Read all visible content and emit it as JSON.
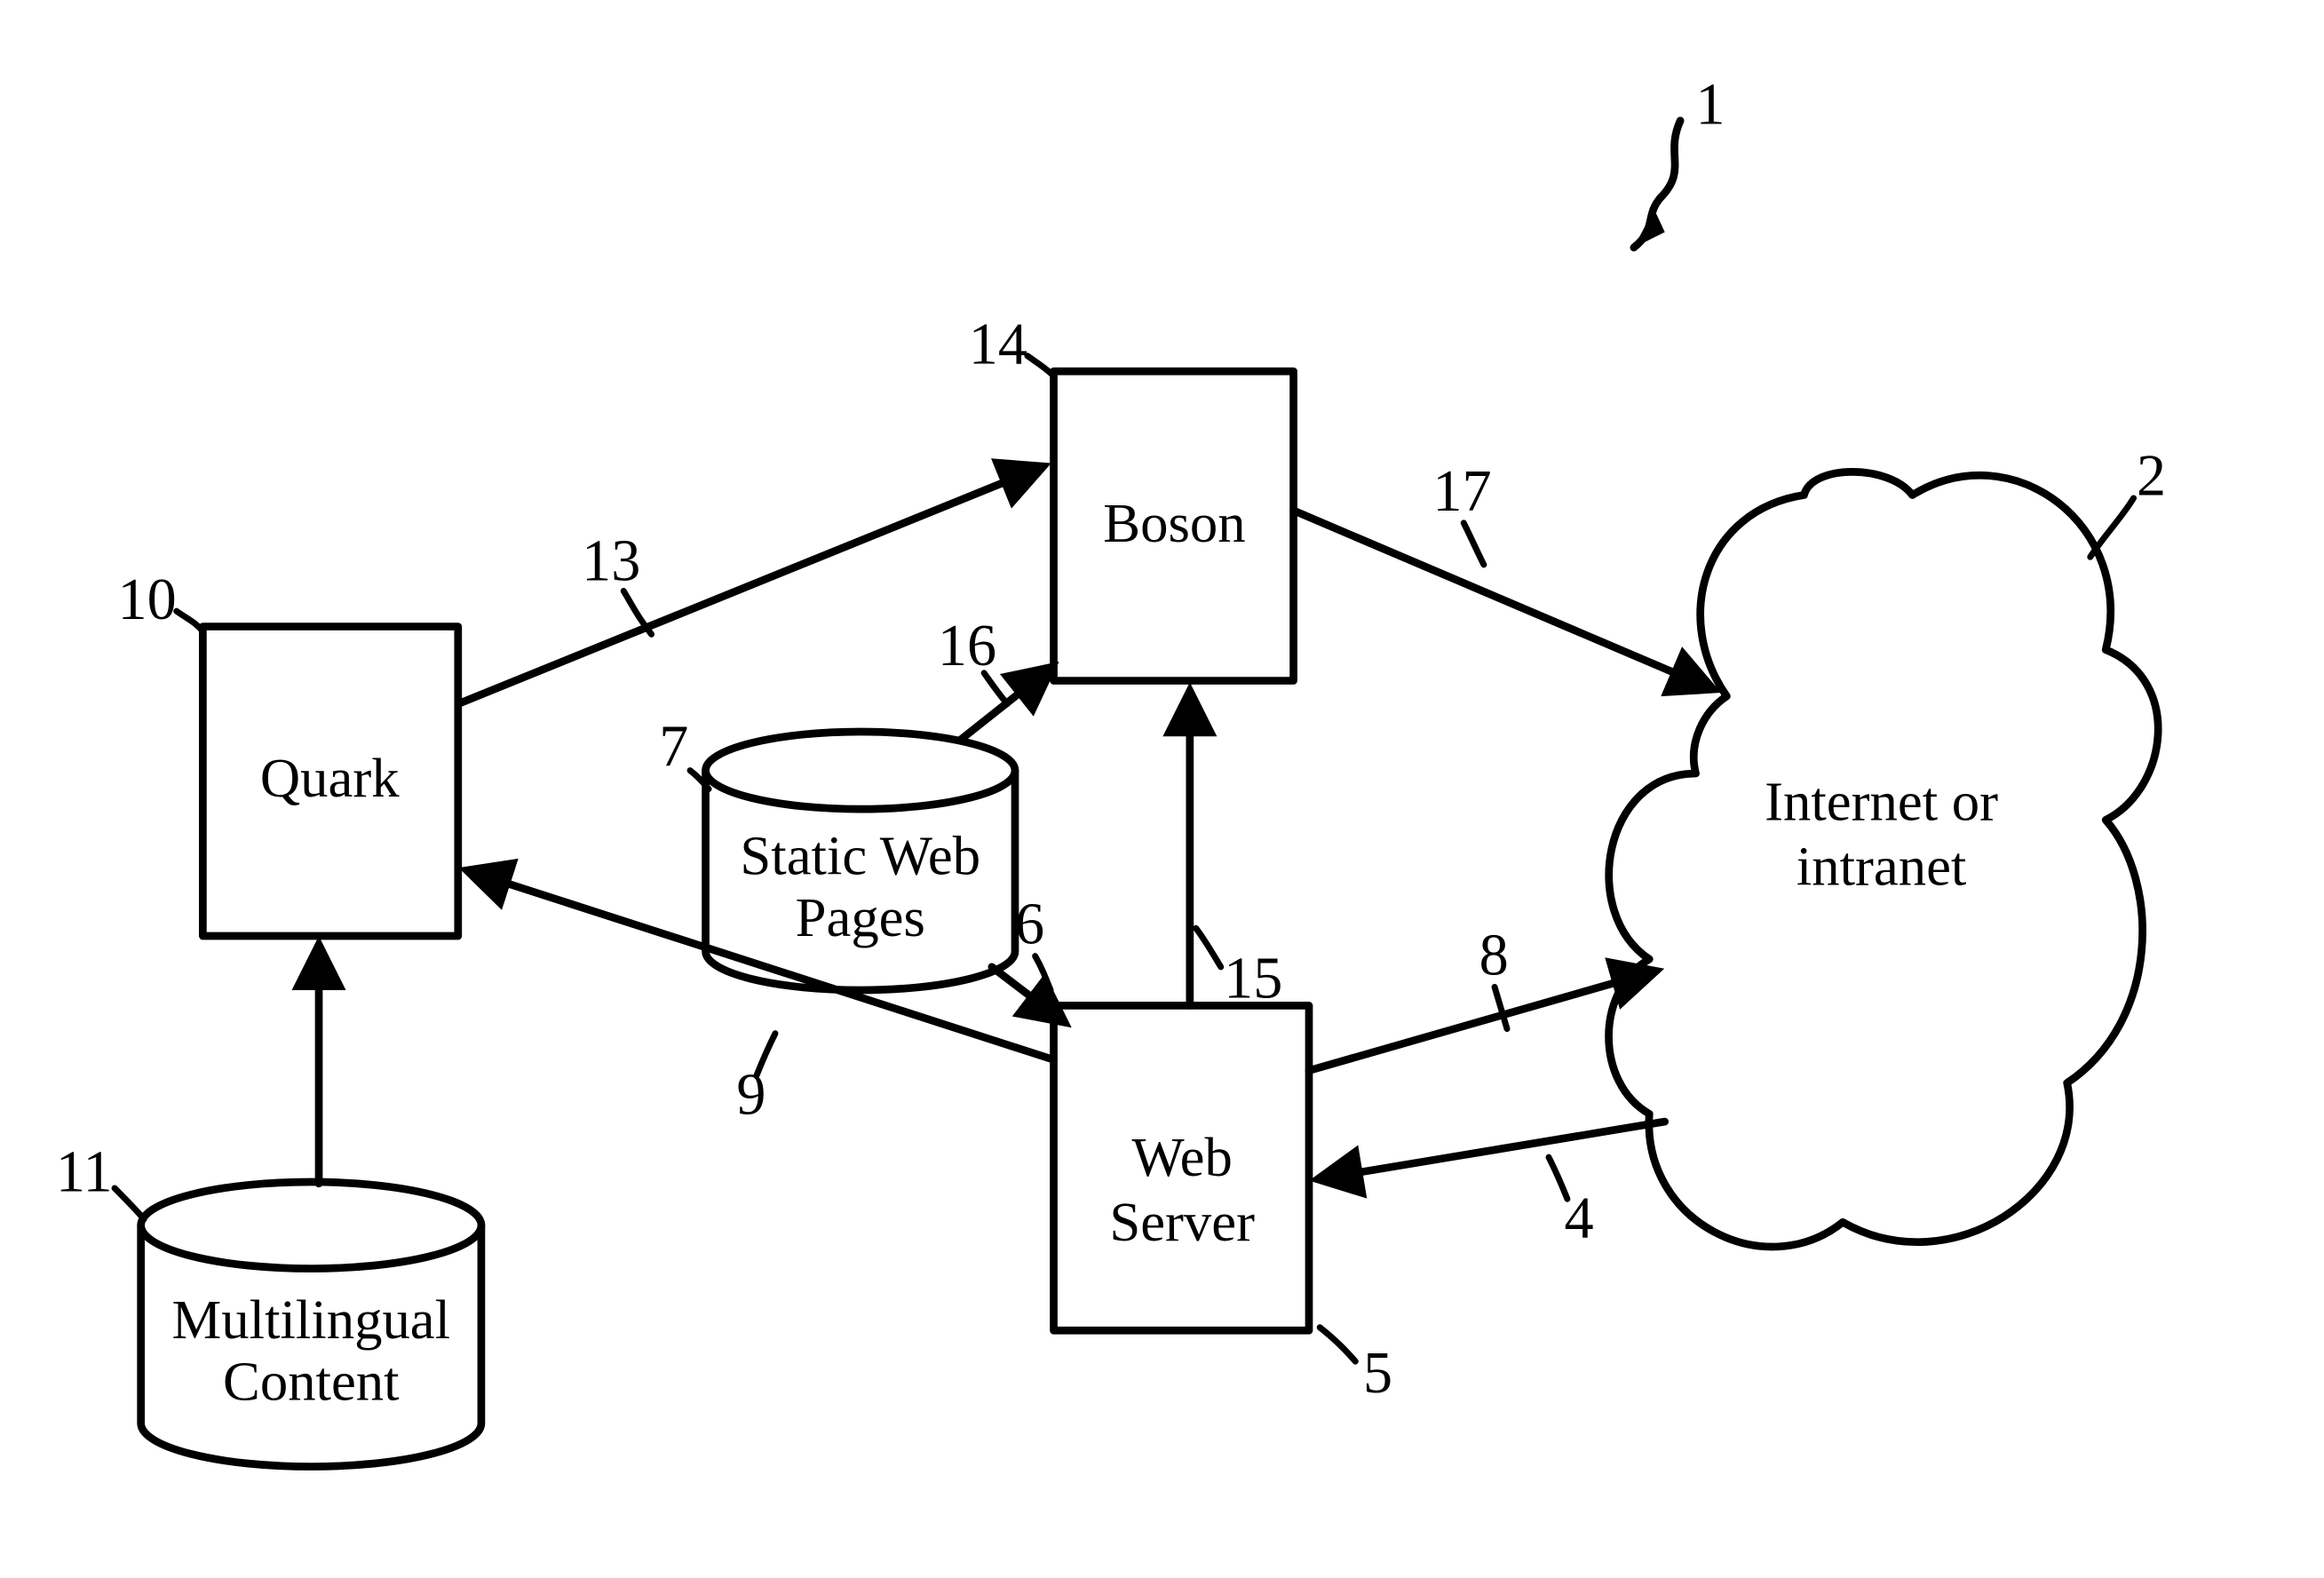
{
  "nodes": {
    "quark": "Quark",
    "boson": "Boson",
    "static_web_pages_l1": "Static Web",
    "static_web_pages_l2": "Pages",
    "web_server_l1": "Web",
    "web_server_l2": "Server",
    "multilingual_l1": "Multilingual",
    "multilingual_l2": "Content",
    "cloud_l1": "Internet or",
    "cloud_l2": "intranet"
  },
  "refs": {
    "r1": "1",
    "r2": "2",
    "r4": "4",
    "r5": "5",
    "r6": "6",
    "r7": "7",
    "r8": "8",
    "r9": "9",
    "r10": "10",
    "r11": "11",
    "r13": "13",
    "r14": "14",
    "r15": "15",
    "r16": "16",
    "r17": "17"
  }
}
